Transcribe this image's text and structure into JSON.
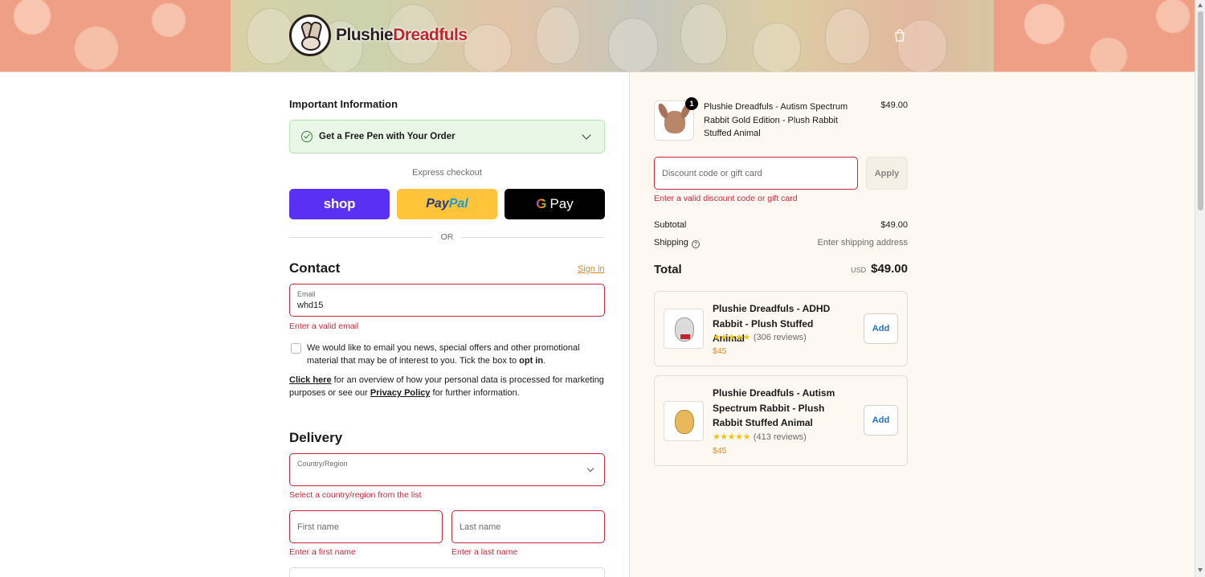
{
  "header": {
    "brand_part1": "Plushie",
    "brand_part2": "Dreadfuls",
    "cart_icon": "shopping-bag-icon"
  },
  "important": {
    "title": "Important Information",
    "promo_label": "Get a Free Pen with Your Order"
  },
  "express": {
    "label": "Express checkout",
    "shop_label": "shop",
    "paypal_part1": "Pay",
    "paypal_part2": "Pal",
    "gpay_g": "G",
    "gpay_label": "Pay",
    "or_label": "OR"
  },
  "contact": {
    "heading": "Contact",
    "signin": "Sign in",
    "email_label": "Email",
    "email_value": "whd15",
    "email_error": "Enter a valid email",
    "optin_text_1": "We would like to email you news, special offers and other promotional material that may be of interest to you. Tick the box to ",
    "optin_bold": "opt in",
    "optin_end": ".",
    "privacy_link1": "Click here",
    "privacy_text1": " for an overview of how your personal data is processed for marketing purposes or see our ",
    "privacy_link2": "Privacy Policy",
    "privacy_text2": " for further information."
  },
  "delivery": {
    "heading": "Delivery",
    "country_label": "Country/Region",
    "country_error": "Select a country/region from the list",
    "first_placeholder": "First name",
    "first_error": "Enter a first name",
    "last_placeholder": "Last name",
    "last_error": "Enter a last name"
  },
  "summary": {
    "item": {
      "qty": "1",
      "name": "Plushie Dreadfuls - Autism Spectrum Rabbit Gold Edition - Plush Rabbit Stuffed Animal",
      "price": "$49.00"
    },
    "discount_placeholder": "Discount code or gift card",
    "apply_label": "Apply",
    "discount_error": "Enter a valid discount code or gift card",
    "subtotal_label": "Subtotal",
    "subtotal_value": "$49.00",
    "shipping_label": "Shipping",
    "shipping_value": "Enter shipping address",
    "total_label": "Total",
    "total_currency": "USD",
    "total_value": "$49.00"
  },
  "upsells": [
    {
      "name": "Plushie Dreadfuls - ADHD Rabbit - Plush Stuffed Animal",
      "stars": "★★★★★",
      "rating": 5,
      "reviews": "(306 reviews)",
      "price": "$45",
      "add_label": "Add"
    },
    {
      "name": "Plushie Dreadfuls - Autism Spectrum Rabbit - Plush Rabbit Stuffed Animal",
      "stars": "★★★★★",
      "rating": 5,
      "reviews": "(413 reviews)",
      "price": "$45",
      "add_label": "Add"
    }
  ],
  "colors": {
    "error": "#c8293a",
    "shop": "#5a31f4",
    "paypal": "#ffc439",
    "link_orange": "#d98a1c",
    "add_blue": "#1f6fd1"
  }
}
